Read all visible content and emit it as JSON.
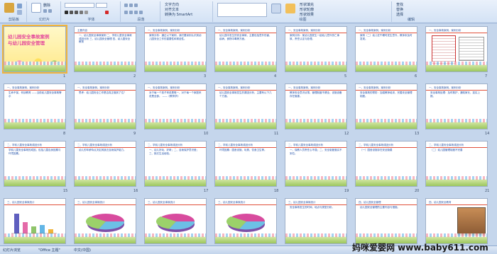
{
  "ribbon": {
    "groups": [
      {
        "label": "剪贴板"
      },
      {
        "label": "幻灯片"
      },
      {
        "label": "字体"
      },
      {
        "label": "段落"
      },
      {
        "label": "绘图"
      },
      {
        "label": "编辑"
      }
    ],
    "paste_label": "粘贴",
    "new_slide_label": "新建\n幻灯片",
    "delete_label": "删除",
    "shape_fill": "形状填充",
    "shape_outline": "形状轮廓",
    "shape_effects": "形状效果",
    "text_direction": "文字方向",
    "align_text": "对齐文本",
    "smartart": "转换为 SmartArt",
    "find": "查找",
    "replace": "替换",
    "select": "选择",
    "arrange": "排列",
    "quick_styles": "快速样式"
  },
  "slides": [
    {
      "n": "1",
      "title": "幼儿园安全事故案例\n与幼儿园安全管理",
      "kind": "title"
    },
    {
      "n": "2",
      "header": "主要内容",
      "body": "一、幼儿园安全事故案例\n二、学前儿童安全事故成因分析\n三、幼儿园安全管理\n四、幼儿园安全教育",
      "kind": "toc"
    },
    {
      "n": "3",
      "header": "一、安全事故案例，案例分析",
      "body": "案例分析：通过以下案例，我们要深刻认识到幼儿园安全工作的重要性和紧迫性。",
      "kind": "text"
    },
    {
      "n": "4",
      "header": "一、安全事故案例，案例分析",
      "body": "幼儿园中发生的安全事故，主要包括意外伤害、疾病、食物中毒等方面。",
      "kind": "text"
    },
    {
      "n": "5",
      "header": "一、安全事故案例，案例分析",
      "body": "案例分析：某幼儿园发生一起幼儿意外伤亡事故，责任认定与处理。",
      "kind": "text"
    },
    {
      "n": "6",
      "header": "一、安全事故案例，案例分析",
      "body": "案例（二）幼儿在午睡时发生意外，教师未及时发现。",
      "kind": "text"
    },
    {
      "n": "7",
      "header": "一、安全事故案例，案例分析",
      "body": "",
      "kind": "news"
    },
    {
      "n": "8",
      "header": "一、安全事故案例，案例分析",
      "body": "生命不保，何谈教育\n——当前幼儿园安全事故警示",
      "kind": "quote"
    },
    {
      "n": "9",
      "header": "一、安全事故案例，案例分析",
      "body": "思考：幼儿园安全工作是否真正做到了位？",
      "kind": "text"
    },
    {
      "n": "10",
      "header": "一、安全事故案例，案例分析",
      "body": "对于每一个孩子来说是唯一，对于每一个家庭来说是全部。\n——《教育学》",
      "kind": "text"
    },
    {
      "n": "11",
      "header": "一、安全事故案例，案例分析",
      "body": "幼儿园安全事故发生的原因分析，主要有以下几个方面。",
      "kind": "text"
    },
    {
      "n": "12",
      "header": "一、安全事故案例，案例分析",
      "body": "教师安全意识淡薄，管理制度不健全，设施设备存在隐患。",
      "kind": "text"
    },
    {
      "n": "13",
      "header": "一、安全事故案例，案例分析",
      "body": "安全事故的预防：加强教师培训，完善安全管理制度。",
      "kind": "text"
    },
    {
      "n": "14",
      "header": "一、安全事故案例，案例分析",
      "body": "安全事故处理：及时救护，通知家长，如实上报。",
      "kind": "text"
    },
    {
      "n": "15",
      "header": "二、学前儿童安全事故成因分析",
      "body": "学前儿童安全事故的成因，包括儿童自身因素与环境因素。",
      "kind": "text"
    },
    {
      "n": "16",
      "header": "二、学前儿童安全事故成因分析",
      "body": "幼儿的年龄特点决定其缺乏自我保护能力。",
      "kind": "text"
    },
    {
      "n": "17",
      "header": "二、学前儿童安全事故成因分析",
      "body": "一、幼儿好动、好奇；二、自我保护意识差；三、缺乏生活经验。",
      "kind": "text"
    },
    {
      "n": "18",
      "header": "二、学前儿童安全事故成因分析",
      "body": "环境因素：园舍设施、玩具、饮食卫生等。",
      "kind": "text"
    },
    {
      "n": "19",
      "header": "二、学前儿童安全事故成因分析",
      "body": "一、保教人员责任心不强；二、安全制度落实不到位。",
      "kind": "text"
    },
    {
      "n": "20",
      "header": "二、学前儿童安全事故成因分析",
      "body": "（一）园舍设施存在安全隐患",
      "kind": "text"
    },
    {
      "n": "21",
      "header": "二、学前儿童安全事故成因分析",
      "body": "（二）幼儿园管理制度不完善",
      "kind": "text"
    },
    {
      "n": "22",
      "header": "三、幼儿园安全事故统计",
      "body": "",
      "kind": "bar"
    },
    {
      "n": "23",
      "header": "三、幼儿园安全事故统计",
      "body": "",
      "kind": "pie"
    },
    {
      "n": "24",
      "header": "三、幼儿园安全事故统计",
      "body": "",
      "kind": "pie"
    },
    {
      "n": "25",
      "header": "三、幼儿园安全事故统计",
      "body": "",
      "kind": "pie"
    },
    {
      "n": "26",
      "header": "三、幼儿园安全事故统计",
      "body": "安全事故发生的时间、地点与类型分析。",
      "kind": "text"
    },
    {
      "n": "27",
      "header": "四、幼儿园安全管理",
      "body": "幼儿园安全管理的主要内容与措施。",
      "kind": "text"
    },
    {
      "n": "28",
      "header": "四、幼儿园安全教育",
      "body": "",
      "kind": "photo"
    }
  ],
  "status": {
    "slide_info": "幻灯片浏览",
    "theme": "\"Office 主题\"",
    "lang": "中文(中国)",
    "zoom": "52%"
  },
  "watermark": "妈咪爱婴网 www.baby611.com"
}
